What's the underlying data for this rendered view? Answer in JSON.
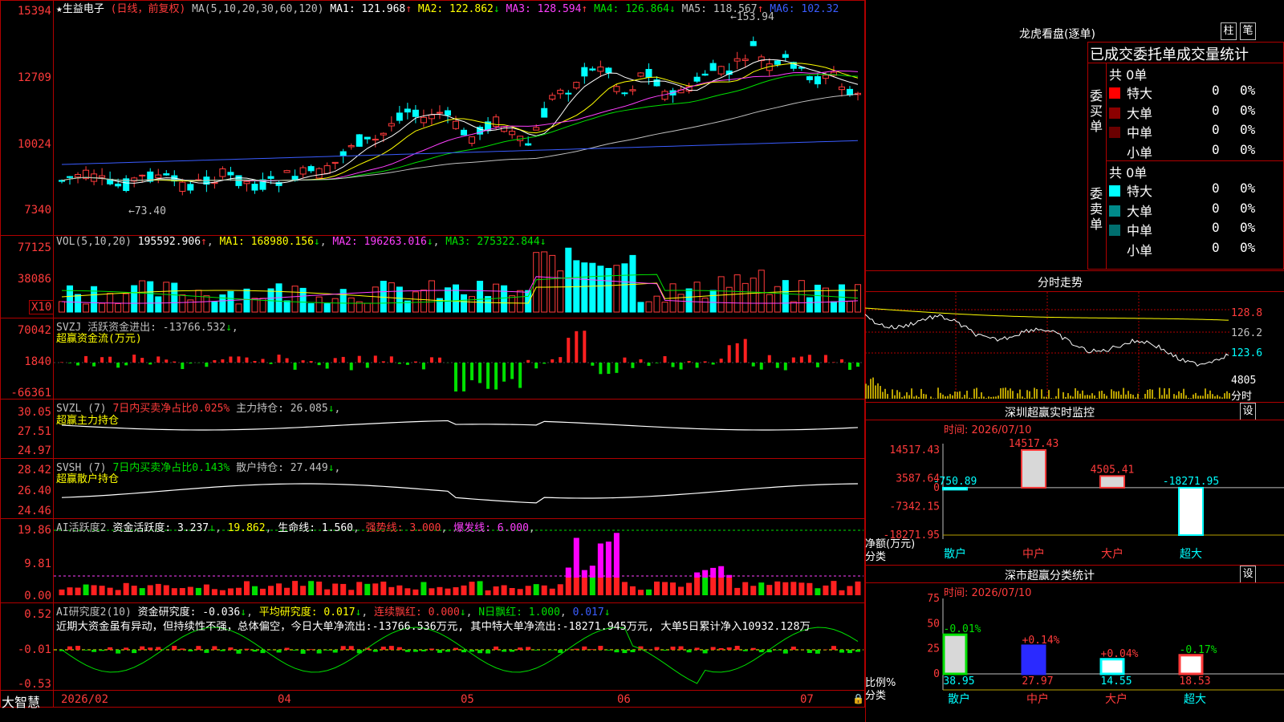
{
  "main_chart": {
    "stock_name": "★生益电子",
    "period_label": "(日线，前复权)",
    "ma_header": "MA(5,10,20,30,60,120)",
    "ma_values": [
      {
        "label": "MA1: 121.968",
        "arrow": "↑",
        "color": "#ffffff"
      },
      {
        "label": "MA2: 122.862",
        "arrow": "↓",
        "color": "#ffff00"
      },
      {
        "label": "MA3: 128.594",
        "arrow": "↑",
        "color": "#ff40ff"
      },
      {
        "label": "MA4: 126.864",
        "arrow": "↓",
        "color": "#00e000"
      },
      {
        "label": "MA5: 118.567",
        "arrow": "↑",
        "color": "#c0c0c0"
      },
      {
        "label": "MA6: 102.32",
        "arrow": "",
        "color": "#3a5cff"
      }
    ],
    "y_labels": [
      "15394",
      "12709",
      "10024",
      "7340"
    ],
    "high_label": "153.94",
    "low_label": "73.40"
  },
  "volume": {
    "header": "VOL(5,10,20)",
    "value": "195592.906",
    "ma1": "MA1: 168980.156",
    "ma2": "MA2: 196263.016",
    "ma3": "MA3: 275322.844",
    "y_labels": [
      "77125",
      "38086"
    ],
    "unit": "X10"
  },
  "svzj": {
    "header": "SVZJ  活跃资金进出: -13766.532",
    "subtitle": "超赢资金流(万元)",
    "y_labels": [
      "70042",
      "1840",
      "-66361"
    ]
  },
  "svzl": {
    "header": "SVZL (7)",
    "ratio": "7日内买卖净占比0.025%",
    "hold": "主力持仓: 26.085",
    "subtitle": "超赢主力持仓",
    "y_labels": [
      "30.05",
      "27.51",
      "24.97"
    ]
  },
  "svsh": {
    "header": "SVSH (7)",
    "ratio": "7日内买卖净占比0.143%",
    "hold": "散户持仓: 27.449",
    "subtitle": "超赢散户持仓",
    "y_labels": [
      "28.42",
      "26.40",
      "24.46"
    ]
  },
  "ai_active": {
    "header": "AI活跃度2",
    "a1": "资金活跃度: 3.237",
    "a2": "19.862",
    "a3": "生命线: 1.560",
    "a4": "强势线: 3.000",
    "a5": "爆发线: 6.000",
    "y_labels": [
      "19.86",
      "9.81",
      "0.00"
    ]
  },
  "ai_research": {
    "header": "AI研究度2(10)",
    "r1": "资金研究度: -0.036",
    "r2": "平均研究度: 0.017",
    "r3": "连续飘红: 0.000",
    "r4": "N日飘红: 1.000",
    "r5": "0.017",
    "commentary": "近期大资金虽有异动，但持续性不强，总体偏空，今日大单净流出:-13766.536万元, 其中特大单净流出:-18271.945万元, 大单5日累计净入10932.128万",
    "y_labels": [
      "0.52",
      "-0.01",
      "-0.53"
    ]
  },
  "x_axis": {
    "brand": "大智慧",
    "labels": [
      "2026/02",
      "04",
      "05",
      "06",
      "07"
    ]
  },
  "side": {
    "dragon_title": "龙虎看盘(逐单)",
    "btn_bar": "柱",
    "btn_pen": "笔",
    "stats_title": "已成交委托单成交量统计",
    "buy_label": "委买单",
    "sell_label": "委卖单",
    "buy_total": "共 0单",
    "sell_total": "共 0单",
    "buy_rows": [
      {
        "name": "特大",
        "count": "0",
        "pct": "0%",
        "color": "#ff0000"
      },
      {
        "name": "大单",
        "count": "0",
        "pct": "0%",
        "color": "#8b0000"
      },
      {
        "name": "中单",
        "count": "0",
        "pct": "0%",
        "color": "#6a0000"
      },
      {
        "name": "小单",
        "count": "0",
        "pct": "0%",
        "color": "#000000"
      }
    ],
    "sell_rows": [
      {
        "name": "特大",
        "count": "0",
        "pct": "0%",
        "color": "#00ffff"
      },
      {
        "name": "大单",
        "count": "0",
        "pct": "0%",
        "color": "#008b8b"
      },
      {
        "name": "中单",
        "count": "0",
        "pct": "0%",
        "color": "#006e6e"
      },
      {
        "name": "小单",
        "count": "0",
        "pct": "0%",
        "color": "#000000"
      }
    ],
    "intraday_title": "分时走势",
    "intraday_y": [
      "128.8",
      "126.2",
      "123.6"
    ],
    "intraday_vol": "4805",
    "intraday_unit": "分时",
    "monitor_title": "深圳超赢实时监控",
    "monitor_btn": "设",
    "monitor_time": "时间: 2026/07/10",
    "monitor_y": [
      "14517.43",
      "3587.64",
      "0",
      "-7342.15",
      "-18271.95"
    ],
    "monitor_bar_labels": [
      "-750.89",
      "14517.43",
      "4505.41",
      "-18271.95"
    ],
    "monitor_axis_title": "净额(万元)",
    "monitor_axis_sub": "分类",
    "categories": [
      "散户",
      "中户",
      "大户",
      "超大"
    ],
    "class_title": "深市超赢分类统计",
    "class_btn": "设",
    "class_time": "时间: 2026/07/10",
    "class_y": [
      "75",
      "50",
      "25",
      "0"
    ],
    "class_changes": [
      "-0.01%",
      "+0.14%",
      "+0.04%",
      "-0.17%"
    ],
    "class_values": [
      "38.95",
      "27.97",
      "14.55",
      "18.53"
    ],
    "class_axis_title": "比例%",
    "class_axis_sub": "分类"
  },
  "chart_data": [
    {
      "type": "bar",
      "title": "深圳超赢实时监控",
      "ylabel": "净额(万元)",
      "categories": [
        "散户",
        "中户",
        "大户",
        "超大"
      ],
      "values": [
        -750.89,
        14517.43,
        4505.41,
        -18271.95
      ],
      "ylim": [
        -18271.95,
        14517.43
      ]
    },
    {
      "type": "bar",
      "title": "深市超赢分类统计",
      "ylabel": "比例%",
      "categories": [
        "散户",
        "中户",
        "大户",
        "超大"
      ],
      "values": [
        38.95,
        27.97,
        14.55,
        18.53
      ],
      "ylim": [
        0,
        75
      ]
    }
  ]
}
